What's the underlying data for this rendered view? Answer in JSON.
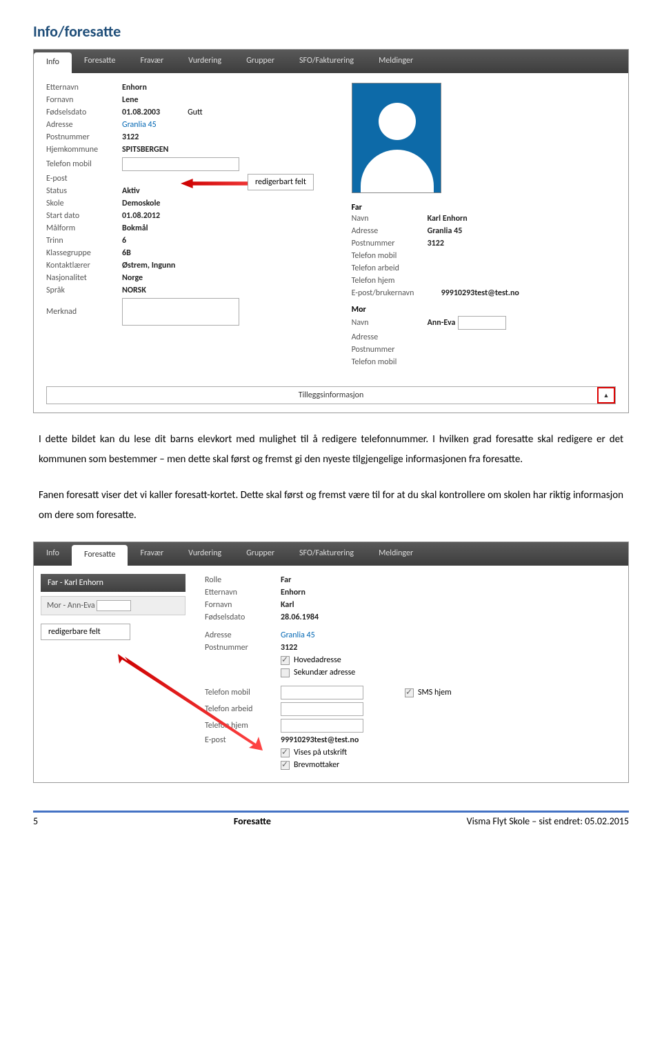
{
  "heading": "Info/foresatte",
  "tabs": [
    "Info",
    "Foresatte",
    "Fravær",
    "Vurdering",
    "Grupper",
    "SFO/Fakturering",
    "Meldinger"
  ],
  "fields_left": {
    "etternavn_lbl": "Etternavn",
    "etternavn": "Enhorn",
    "fornavn_lbl": "Fornavn",
    "fornavn": "Lene",
    "fdato_lbl": "Fødselsdato",
    "fdato": "01.08.2003",
    "kjonn": "Gutt",
    "adresse_lbl": "Adresse",
    "adresse": "Granlia 45",
    "postnr_lbl": "Postnummer",
    "postnr": "3122",
    "hjemkom_lbl": "Hjemkommune",
    "hjemkom": "SPITSBERGEN",
    "tlf_lbl": "Telefon mobil",
    "epost_lbl": "E-post",
    "status_lbl": "Status",
    "status": "Aktiv",
    "skole_lbl": "Skole",
    "skole": "Demoskole",
    "start_lbl": "Start dato",
    "start": "01.08.2012",
    "malform_lbl": "Målform",
    "malform": "Bokmål",
    "trinn_lbl": "Trinn",
    "trinn": "6",
    "klasse_lbl": "Klassegruppe",
    "klasse": "6B",
    "kontakt_lbl": "Kontaktlærer",
    "kontakt": "Østrem, Ingunn",
    "nasj_lbl": "Nasjonalitet",
    "nasj": "Norge",
    "sprak_lbl": "Språk",
    "sprak": "NORSK",
    "merk_lbl": "Merknad"
  },
  "callout1": "redigerbart felt",
  "far": {
    "title": "Far",
    "navn_lbl": "Navn",
    "navn": "Karl Enhorn",
    "adresse_lbl": "Adresse",
    "adresse": "Granlia 45",
    "postnr_lbl": "Postnummer",
    "postnr": "3122",
    "tlfmob_lbl": "Telefon mobil",
    "tlfarb_lbl": "Telefon arbeid",
    "tlfhj_lbl": "Telefon hjem",
    "epost_lbl": "E-post/brukernavn",
    "epost": "99910293test@test.no"
  },
  "mor": {
    "title": "Mor",
    "navn_lbl": "Navn",
    "navn": "Ann-Eva",
    "adresse_lbl": "Adresse",
    "postnr_lbl": "Postnummer",
    "tlfmob_lbl": "Telefon mobil"
  },
  "extrainfo": "Tilleggsinformasjon",
  "para1": "I dette bildet kan du lese dit barns elevkort med mulighet til å redigere telefonnummer. I hvilken grad foresatte skal redigere er det kommunen som bestemmer – men dette skal først og fremst gi den nyeste tilgjengelige informasjonen fra foresatte.",
  "para2": "Fanen foresatt viser det vi kaller foresatt-kortet. Dette skal først og fremst være til for at du skal kontrollere om skolen har riktig informasjon om dere som foresatte.",
  "shot2": {
    "sidebar_far": "Far - Karl Enhorn",
    "sidebar_mor": "Mor - Ann-Eva",
    "callout": "redigerbare felt",
    "rolle_lbl": "Rolle",
    "rolle": "Far",
    "etternavn_lbl": "Etternavn",
    "etternavn": "Enhorn",
    "fornavn_lbl": "Fornavn",
    "fornavn": "Karl",
    "fdato_lbl": "Fødselsdato",
    "fdato": "28.06.1984",
    "adresse_lbl": "Adresse",
    "adresse": "Granlia 45",
    "postnr_lbl": "Postnummer",
    "postnr": "3122",
    "hoved": "Hovedadresse",
    "sek": "Sekundær adresse",
    "tlfmob_lbl": "Telefon mobil",
    "sms": "SMS hjem",
    "tlfarb_lbl": "Telefon arbeid",
    "tlfhj_lbl": "Telefon hjem",
    "epost_lbl": "E-post",
    "epost": "99910293test@test.no",
    "vises": "Vises på utskrift",
    "brev": "Brevmottaker"
  },
  "footer": {
    "page": "5",
    "center": "Foresatte",
    "right": "Visma Flyt Skole – sist endret: 05.02.2015"
  }
}
